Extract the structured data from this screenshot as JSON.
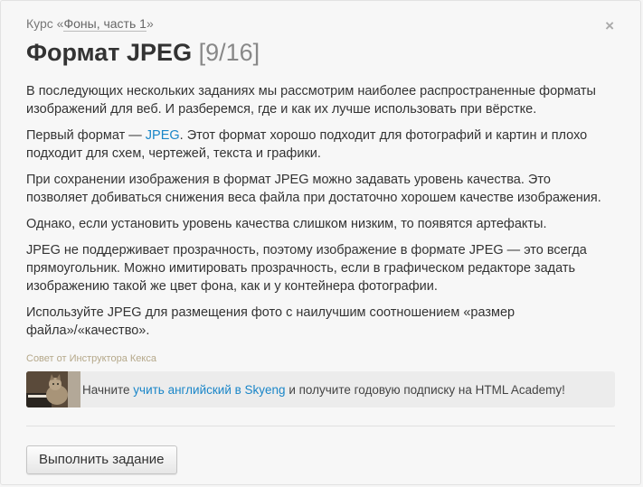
{
  "header": {
    "course_prefix": "Курс «",
    "course_name": "Фоны, часть 1",
    "course_suffix": "»",
    "close_symbol": "×"
  },
  "title": {
    "text": "Формат JPEG",
    "step": "[9/16]"
  },
  "content": {
    "p1": "В последующих нескольких заданиях мы рассмотрим наиболее распространенные форматы изображений для веб. И разберемся, где и как их лучше использовать при вёрстке.",
    "p2_before": "Первый формат — ",
    "p2_link": "JPEG",
    "p2_after": ". Этот формат хорошо подходит для фотографий и картин и плохо подходит для схем, чертежей, текста и графики.",
    "p3": "При сохранении изображения в формат JPEG можно задавать уровень качества. Это позволяет добиваться снижения веса файла при достаточно хорошем качестве изображения.",
    "p4": "Однако, если установить уровень качества слишком низким, то появятся артефакты.",
    "p5": "JPEG не поддерживает прозрачность, поэтому изображение в формате JPEG — это всегда прямоугольник. Можно имитировать прозрачность, если в графическом редакторе задать изображению такой же цвет фона, как и у контейнера фотографии.",
    "p6": "Используйте JPEG для размещения фото с наилучшим соотношением «размер файла»/«качество»."
  },
  "tip": {
    "label": "Совет от Инструктора Кекса"
  },
  "promo": {
    "before": "Начните ",
    "link": "учить английский в Skyeng",
    "after": " и получите годовую подписку на HTML Academy!"
  },
  "actions": {
    "submit_label": "Выполнить задание"
  },
  "colors": {
    "link": "#1a86c8",
    "background": "#f7f7f7",
    "promo_background": "#ececec"
  }
}
